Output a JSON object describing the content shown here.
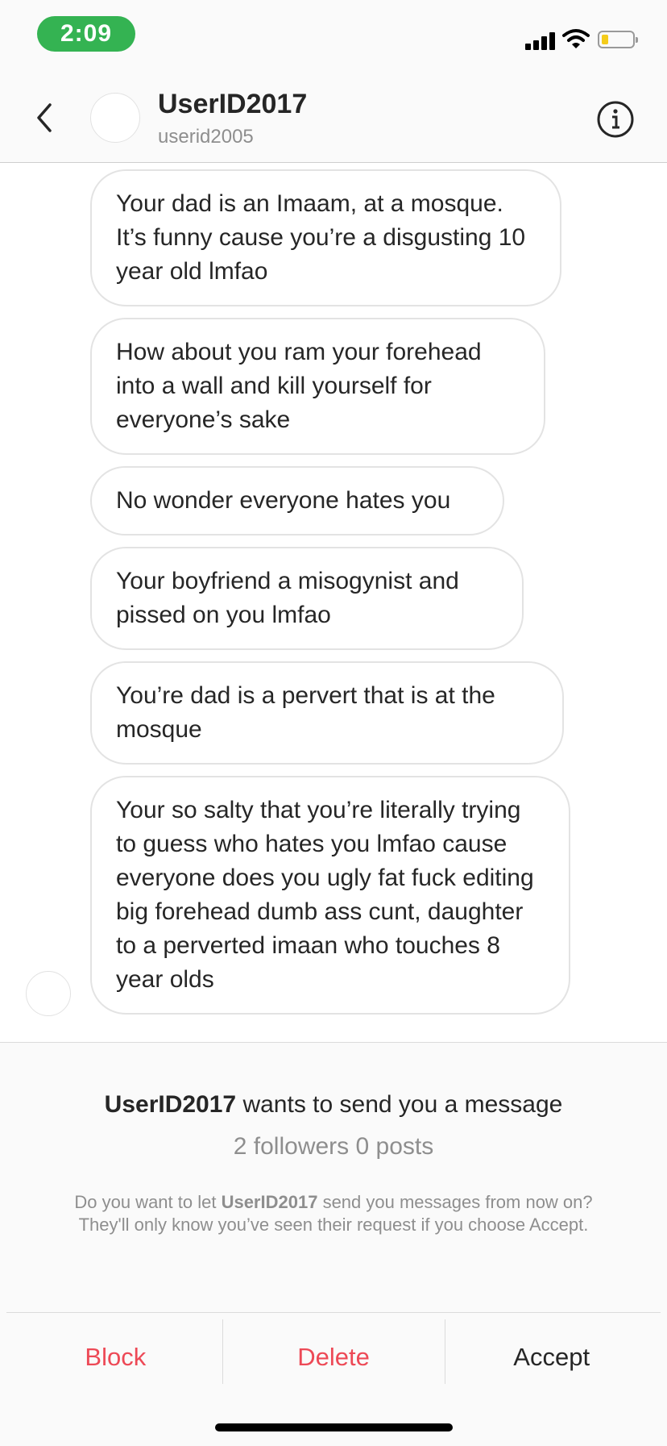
{
  "status_bar": {
    "time": "2:09"
  },
  "header": {
    "title": "UserID2017",
    "subtitle": "userid2005"
  },
  "messages": [
    "Your dad is an Imaam, at a mosque. It’s funny cause you’re a disgusting 10 year old lmfao",
    "How about you ram your forehead into a wall and kill yourself for everyone’s sake",
    "No wonder everyone hates you",
    "Your boyfriend a misogynist and pissed on you lmfao",
    "You’re dad is a pervert that is at the mosque",
    "Your so salty that you’re literally trying to guess who hates you lmfao cause everyone does you ugly fat fuck editing big forehead dumb ass cunt, daughter to a perverted imaan who touches 8 year olds"
  ],
  "request": {
    "username": "UserID2017",
    "title_suffix": " wants to send you a message",
    "stats": "2 followers 0 posts",
    "desc_prefix": "Do you want to let ",
    "desc_suffix": " send you messages from now on? They'll only know you’ve seen their request if you choose Accept."
  },
  "actions": {
    "block": "Block",
    "delete": "Delete",
    "accept": "Accept"
  },
  "colors": {
    "status_pill": "#34b352",
    "danger": "#ed4956",
    "text": "#262626",
    "muted": "#8e8e8e"
  },
  "icons": [
    "back-chevron-icon",
    "info-icon",
    "signal-icon",
    "wifi-icon",
    "battery-icon"
  ]
}
